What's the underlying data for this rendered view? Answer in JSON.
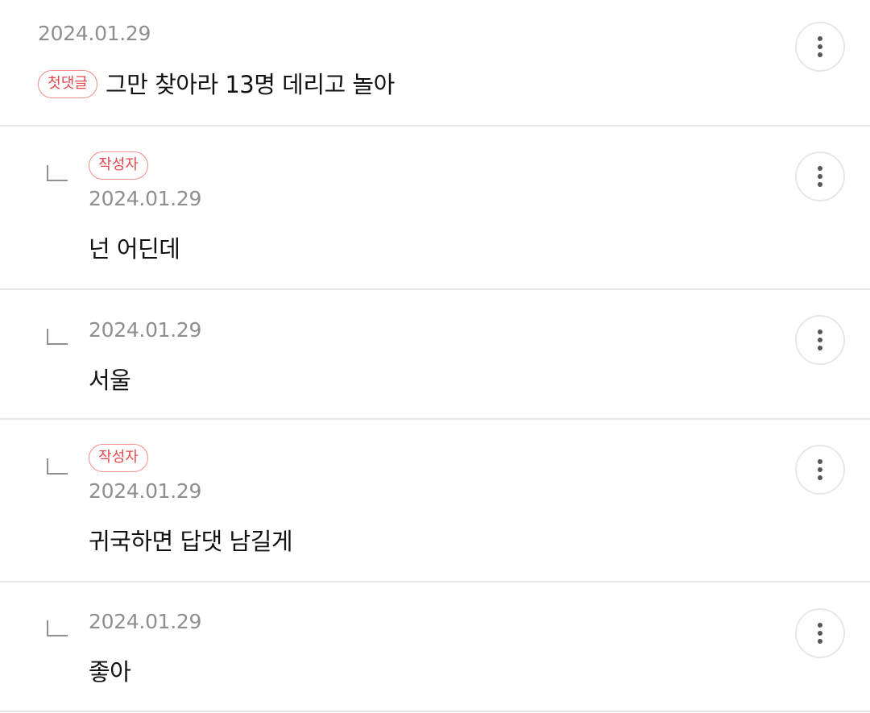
{
  "badges": {
    "first_comment": "첫댓글",
    "author": "작성자"
  },
  "comments": [
    {
      "date": "2024.01.29",
      "text": "그만 찾아라 13명 데리고 놀아"
    },
    {
      "date": "2024.01.29",
      "text": "넌 어딘데"
    },
    {
      "date": "2024.01.29",
      "text": "서울"
    },
    {
      "date": "2024.01.29",
      "text": "귀국하면 답댓 남길게"
    },
    {
      "date": "2024.01.29",
      "text": "좋아"
    }
  ],
  "icons": {
    "more": "more-vertical-icon",
    "reply": "reply-arrow-icon"
  },
  "colors": {
    "badge_text": "#e5484d",
    "badge_border": "#f28b8b",
    "date": "#8e8e8e",
    "divider": "#e6e6e6"
  }
}
